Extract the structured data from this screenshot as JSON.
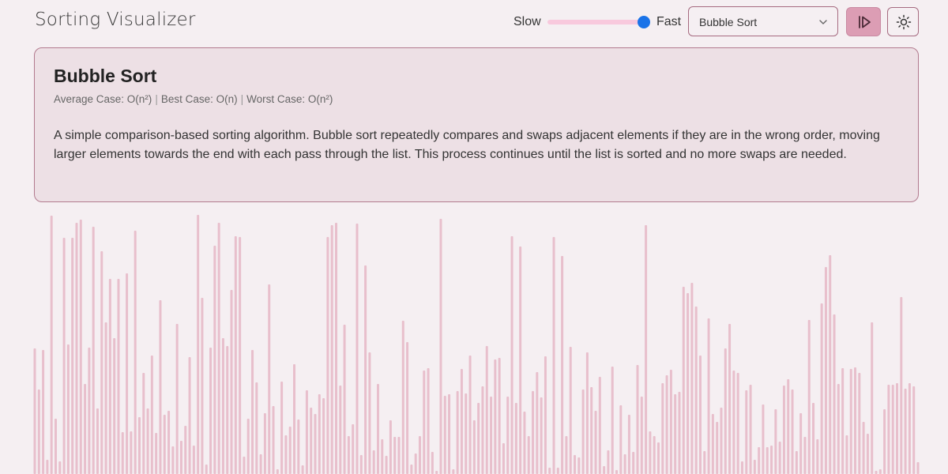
{
  "header": {
    "title": "Sorting Visualizer",
    "speed_slow_label": "Slow",
    "speed_fast_label": "Fast",
    "speed_value": 1.0,
    "algorithm_selected": "Bubble Sort"
  },
  "card": {
    "title": "Bubble Sort",
    "average_case": "Average Case: O(n²)",
    "best_case": "Best Case: O(n)",
    "worst_case": "Worst Case: O(n²)",
    "description": "A simple comparison-based sorting algorithm. Bubble sort repeatedly compares and swaps adjacent elements if they are in the wrong order, moving larger elements towards the end with each pass through the list. This process continues until the list is sorted and no more swaps are needed."
  },
  "colors": {
    "background": "#f5eff2",
    "card_background": "#ede0e5",
    "card_border": "#b27a8e",
    "bar_color": "#e8bfcc",
    "slider_track": "#f8c9dd",
    "slider_thumb": "#1a73e8",
    "play_button_bg": "#dc9db4"
  },
  "icons": {
    "play": "play-step-icon",
    "theme": "sun-icon",
    "dropdown": "chevron-down-icon"
  },
  "array_values": [
    159,
    107,
    157,
    18,
    327,
    70,
    16,
    299,
    164,
    299,
    318,
    322,
    114,
    160,
    313,
    83,
    282,
    192,
    247,
    172,
    247,
    53,
    254,
    54,
    308,
    72,
    128,
    83,
    150,
    52,
    220,
    75,
    80,
    35,
    190,
    42,
    61,
    148,
    36,
    328,
    223,
    12,
    160,
    289,
    318,
    172,
    162,
    233,
    301,
    300,
    22,
    70,
    157,
    116,
    25,
    77,
    240,
    86,
    6,
    117,
    49,
    60,
    139,
    69,
    11,
    106,
    84,
    76,
    101,
    96,
    300,
    315,
    318,
    112,
    189,
    48,
    63,
    317,
    24,
    264,
    154,
    30,
    114,
    44,
    23,
    68,
    47,
    47,
    194,
    167,
    12,
    26,
    48,
    131,
    134,
    28,
    4,
    323,
    99,
    101,
    6,
    105,
    133,
    102,
    150,
    68,
    90,
    111,
    162,
    98,
    145,
    147,
    39,
    98,
    301,
    90,
    288,
    79,
    48,
    105,
    129,
    97,
    149,
    8,
    300,
    8,
    276,
    48,
    161,
    24,
    21,
    107,
    154,
    110,
    80,
    123,
    10,
    30,
    136,
    5,
    87,
    25,
    75,
    28,
    138,
    98,
    315,
    54,
    48,
    40,
    115,
    125,
    132,
    101,
    104,
    237,
    229,
    242,
    212,
    150,
    29,
    197,
    76,
    66,
    84,
    159,
    190,
    131,
    128,
    16,
    106,
    113,
    18,
    34,
    88,
    34,
    36,
    82,
    41,
    112,
    120,
    107,
    29,
    77,
    47,
    195,
    90,
    44,
    216,
    262,
    277,
    202,
    114,
    134,
    49,
    133,
    135,
    128,
    66,
    51,
    192,
    4,
    6,
    82,
    113,
    113,
    115,
    224,
    108,
    115,
    111,
    15
  ],
  "array_max": 330
}
